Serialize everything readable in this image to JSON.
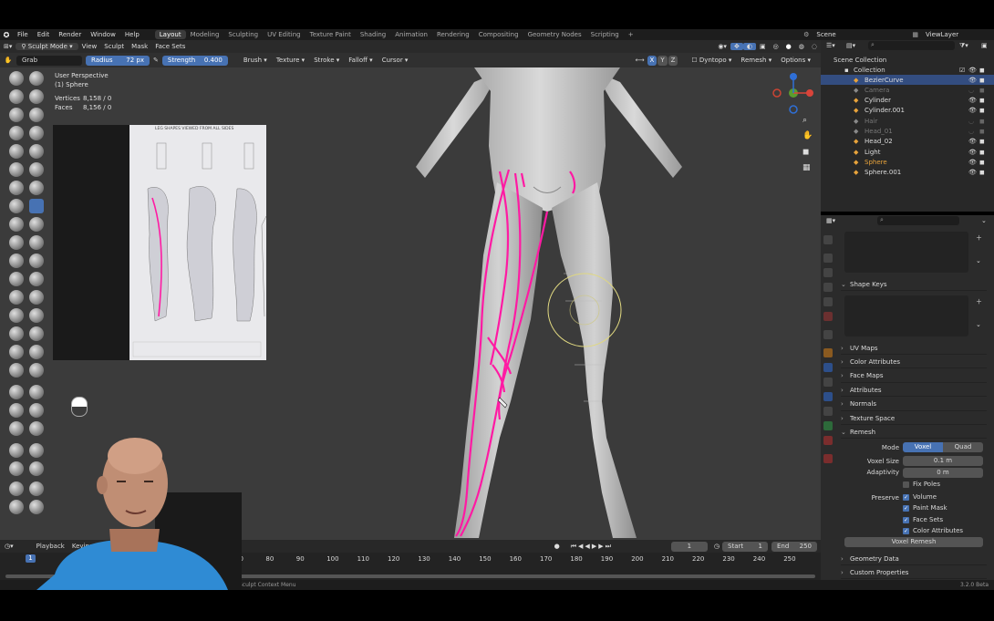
{
  "menubar": {
    "menus": [
      "File",
      "Edit",
      "Render",
      "Window",
      "Help"
    ],
    "workspaces": [
      "Layout",
      "Modeling",
      "Sculpting",
      "UV Editing",
      "Texture Paint",
      "Shading",
      "Animation",
      "Rendering",
      "Compositing",
      "Geometry Nodes",
      "Scripting"
    ],
    "active_workspace": "Layout",
    "scene": "Scene",
    "view_layer": "ViewLayer"
  },
  "header": {
    "mode": "Sculpt Mode",
    "menus": [
      "View",
      "Sculpt",
      "Mask",
      "Face Sets"
    ]
  },
  "tool_settings": {
    "brush_name": "Grab",
    "radius_label": "Radius",
    "radius_value": "72 px",
    "strength_label": "Strength",
    "strength_value": "0.400",
    "dropdowns": [
      "Brush",
      "Texture",
      "Stroke",
      "Falloff",
      "Cursor"
    ],
    "axes": [
      "X",
      "Y",
      "Z"
    ],
    "dyntopo": "Dyntopo",
    "remesh": "Remesh",
    "options": "Options"
  },
  "viewport": {
    "perspective": "User Perspective",
    "object": "(1) Sphere",
    "vertices_label": "Vertices",
    "vertices_value": "8,158 / 0",
    "faces_label": "Faces",
    "faces_value": "8,156 / 0",
    "reference_title": "LEG SHAPES VIEWED FROM ALL SIDES"
  },
  "outliner": {
    "scene_collection": "Scene Collection",
    "collection": "Collection",
    "items": [
      {
        "name": "BezierCurve",
        "color": "#e8a33b",
        "selected": true,
        "dim": false
      },
      {
        "name": "Camera",
        "color": "#8a8a8a",
        "selected": false,
        "dim": true
      },
      {
        "name": "Cylinder",
        "color": "#e8a33b",
        "selected": false,
        "dim": false
      },
      {
        "name": "Cylinder.001",
        "color": "#e8a33b",
        "selected": false,
        "dim": false
      },
      {
        "name": "Hair",
        "color": "#8a8a8a",
        "selected": false,
        "dim": true
      },
      {
        "name": "Head_01",
        "color": "#8a8a8a",
        "selected": false,
        "dim": true
      },
      {
        "name": "Head_02",
        "color": "#e8a33b",
        "selected": false,
        "dim": false
      },
      {
        "name": "Light",
        "color": "#e8a33b",
        "selected": false,
        "dim": false
      },
      {
        "name": "Sphere",
        "color": "#e8a33b",
        "selected": false,
        "dim": false,
        "active": true
      },
      {
        "name": "Sphere.001",
        "color": "#e8a33b",
        "selected": false,
        "dim": false
      }
    ]
  },
  "properties": {
    "shape_keys": "Shape Keys",
    "sections": [
      "UV Maps",
      "Color Attributes",
      "Face Maps",
      "Attributes",
      "Normals",
      "Texture Space"
    ],
    "remesh": {
      "title": "Remesh",
      "mode_label": "Mode",
      "mode_voxel": "Voxel",
      "mode_quad": "Quad",
      "voxel_size_label": "Voxel Size",
      "voxel_size_value": "0.1 m",
      "adaptivity_label": "Adaptivity",
      "adaptivity_value": "0 m",
      "fix_poles": "Fix Poles",
      "preserve_label": "Preserve",
      "preserve": [
        "Volume",
        "Paint Mask",
        "Face Sets",
        "Color Attributes"
      ],
      "button": "Voxel Remesh"
    },
    "bottom_sections": [
      "Geometry Data",
      "Custom Properties"
    ]
  },
  "timeline": {
    "menus": [
      "Playback",
      "Keying"
    ],
    "current_frame": "1",
    "start_label": "Start",
    "start_value": "1",
    "end_label": "End",
    "end_value": "250",
    "ticks": [
      "70",
      "80",
      "90",
      "100",
      "110",
      "120",
      "130",
      "140",
      "150",
      "160",
      "170",
      "180",
      "190",
      "200",
      "210",
      "220",
      "230",
      "240",
      "250"
    ],
    "playhead": "1"
  },
  "status": {
    "text": "Sculpt Context Menu",
    "version": "3.2.0 Beta"
  },
  "colors": {
    "accent": "#4772b3",
    "curve": "#ff1aa3",
    "selected_row": "#334d80"
  }
}
